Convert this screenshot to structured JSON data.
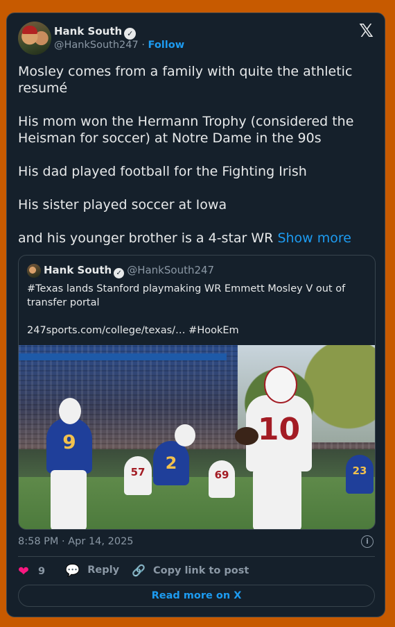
{
  "author": {
    "name": "Hank South",
    "handle": "@HankSouth247",
    "separator": "·",
    "follow_label": "Follow",
    "verified_glyph": "✓"
  },
  "brand": {
    "logo_glyph": "𝕏"
  },
  "tweet": {
    "paragraphs": [
      "Mosley comes from a family with quite the athletic resumé",
      "His mom won the Hermann Trophy (considered the Heisman for soccer) at Notre Dame in the 90s",
      "His dad played football for the Fighting Irish",
      "His sister played soccer at Iowa"
    ],
    "last_line": "and his younger brother is a 4-star WR",
    "show_more_label": "Show more"
  },
  "quote": {
    "author_name": "Hank South",
    "author_handle": "@HankSouth247",
    "text": "#Texas lands Stanford playmaking WR Emmett Mosley V out of transfer portal",
    "link_line": "247sports.com/college/texas/… #HookEm",
    "image": {
      "jersey_numbers": [
        "9",
        "10",
        "2",
        "57",
        "69",
        "23"
      ]
    }
  },
  "timestamp": "8:58 PM · Apr 14, 2025",
  "actions": {
    "like_count": "9",
    "reply_label": "Reply",
    "copy_label": "Copy link to post"
  },
  "read_more_label": "Read more on X",
  "colors": {
    "background": "#c75a00",
    "card": "#15202b",
    "accent": "#1d9bf0",
    "like": "#f91880",
    "muted": "#8b98a5"
  },
  "icons": {
    "logo": "x-logo-icon",
    "verified": "verified-badge-icon",
    "info": "info-icon",
    "like": "heart-icon",
    "reply": "reply-icon",
    "copy": "link-icon"
  }
}
